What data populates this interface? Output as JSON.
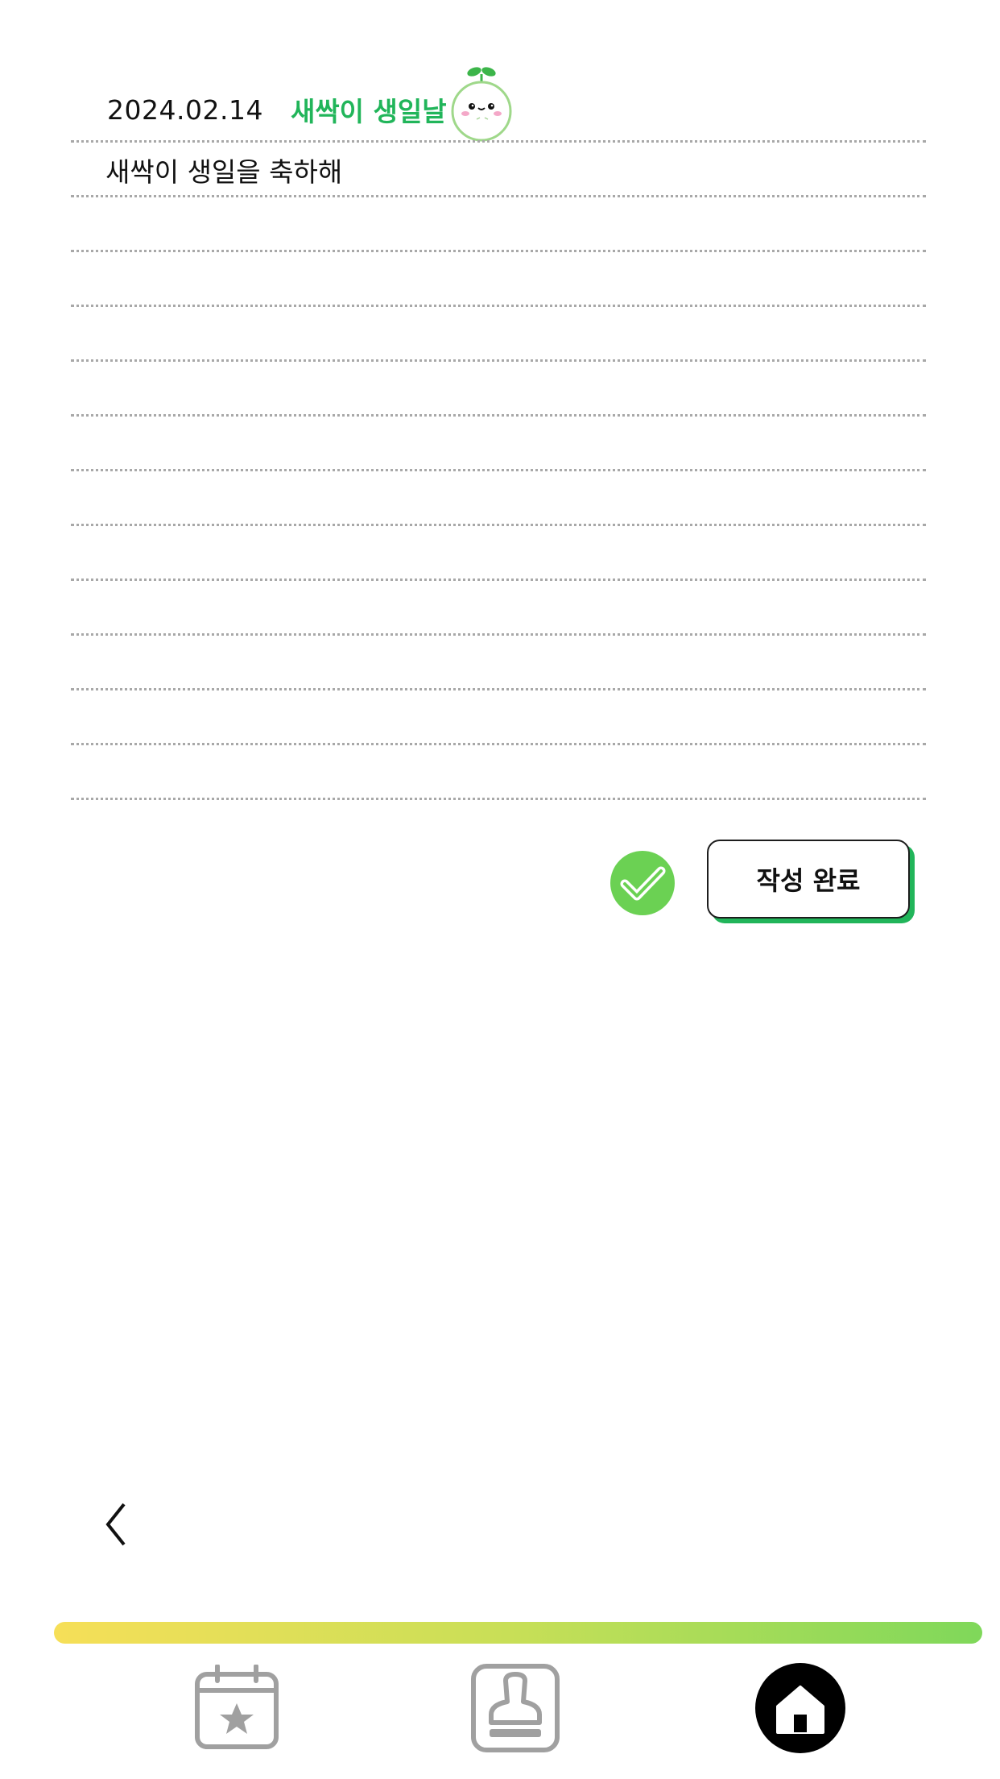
{
  "header": {
    "date": "2024.02.14",
    "title": "새싹이 생일날"
  },
  "diary": {
    "text": "새싹이 생일을 축하해"
  },
  "actions": {
    "done_label": "작성 완료"
  },
  "colors": {
    "accent_green": "#21b55a",
    "check_green": "#6bd153",
    "bar_start": "#f6df58",
    "bar_end": "#7fd85a"
  },
  "icons": {
    "mascot": "sprout-mascot-icon",
    "check": "check-circle-icon",
    "back": "chevron-left-icon",
    "nav": [
      "calendar-star-icon",
      "stamp-icon",
      "home-icon"
    ]
  }
}
